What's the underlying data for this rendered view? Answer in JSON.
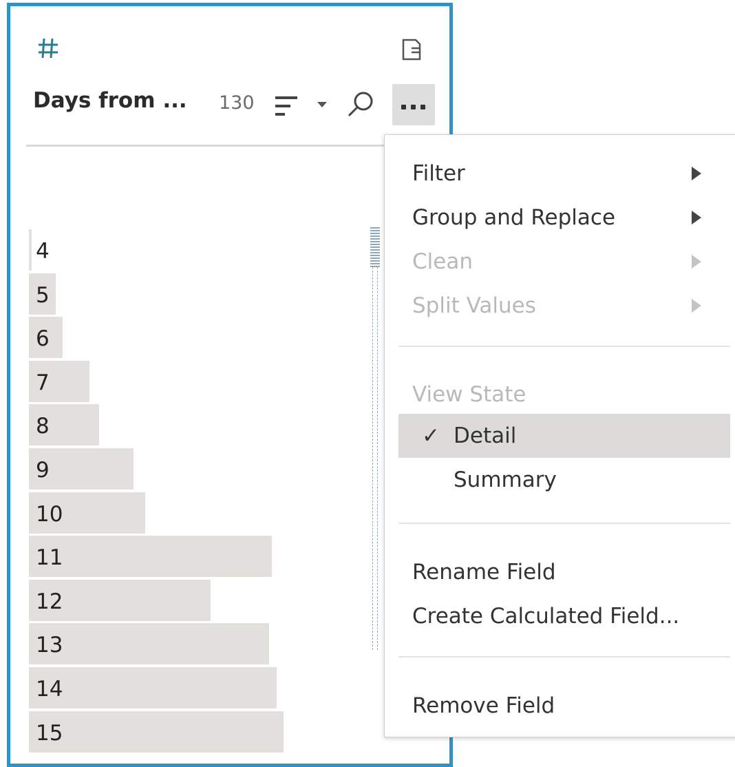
{
  "field_card": {
    "type_icon": "number-hash-icon",
    "title": "Days from ...",
    "count": "130",
    "border_color": "#2e93c7",
    "bars": [
      {
        "label": "4",
        "value": 0.0
      },
      {
        "label": "5",
        "value": 0.11
      },
      {
        "label": "6",
        "value": 0.14
      },
      {
        "label": "7",
        "value": 0.25
      },
      {
        "label": "8",
        "value": 0.29
      },
      {
        "label": "9",
        "value": 0.43
      },
      {
        "label": "10",
        "value": 0.48
      },
      {
        "label": "11",
        "value": 1.0
      },
      {
        "label": "12",
        "value": 0.75
      },
      {
        "label": "13",
        "value": 0.99
      },
      {
        "label": "14",
        "value": 1.02
      },
      {
        "label": "15",
        "value": 1.05
      }
    ]
  },
  "context_menu": {
    "filter": "Filter",
    "group_replace": "Group and Replace",
    "clean": "Clean",
    "split_values": "Split Values",
    "view_state": "View State",
    "detail": "Detail",
    "check": "✓",
    "summary": "Summary",
    "rename_field": "Rename Field",
    "create_calc": "Create Calculated Field...",
    "remove_field": "Remove Field"
  }
}
